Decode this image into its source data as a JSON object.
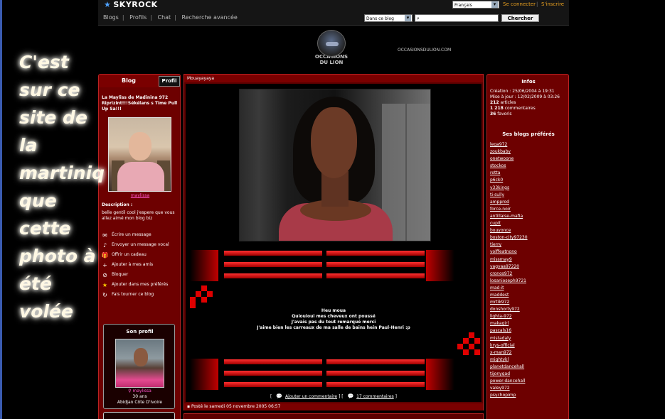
{
  "topbar": {
    "logo": "SKYROCK",
    "nav": [
      "Blogs",
      "Profils",
      "Chat",
      "Recherche avancée"
    ],
    "language": "Français",
    "login": "Se connecter",
    "register": "S'inscrire",
    "search_scope": "Dans ce blog",
    "search_value": "",
    "search_button": "Chercher"
  },
  "brand": {
    "line1": "OCCASIONS",
    "line2": "DU LION",
    "url": "OCCASIONSDULION.COM"
  },
  "caption": "C'est\nsur ce\nsite de\nla\nmartiniq\nque\ncette\nphoto à\nété\nvolée",
  "left": {
    "tab_blog": "Blog",
    "tab_profil": "Profil",
    "blog_title": "La Mayliss de Madinina 972 Riprizint!!!Sékélans s Time Pull Up Sa!!!",
    "username": "maylissa",
    "description_label": "Description :",
    "description": "belle gentil cool j'espere que vous allez aimé mon blog biz",
    "actions": [
      {
        "icon": "✉",
        "label": "Écrire un message"
      },
      {
        "icon": "♪",
        "label": "Envoyer un message vocal"
      },
      {
        "icon": "🎁",
        "label": "Offrir un cadeau"
      },
      {
        "icon": "+",
        "label": "Ajouter à mes amis"
      },
      {
        "icon": "⊘",
        "label": "Bloquer"
      },
      {
        "icon": "★",
        "label": "Ajouter dans mes préférés"
      },
      {
        "icon": "↻",
        "label": "Fais tourner ce blog"
      }
    ],
    "profile": {
      "heading": "Son profil",
      "name": "maylissa",
      "age": "30 ans",
      "location": "Abidjan Côte D'Ivoire"
    }
  },
  "center": {
    "header": "Mouayayaya",
    "message": [
      "Heu moua",
      "Quiouioui mes cheveux ont poussé",
      "J'avais pas du tout remarqué merci",
      "J'aime bien les carreaux de ma salle de bains hein Paul-Henri :p"
    ],
    "add_comment": "Ajouter un commentaire",
    "comment_count": "17 commentaires",
    "posted": "Posté le samedi 05 novembre 2005 06:57"
  },
  "right": {
    "info_heading": "Infos",
    "creation_label": "Création :",
    "creation": "25/06/2004 à 19:31",
    "update_label": "Mise à jour :",
    "update": "12/02/2009 à 03:26",
    "articles_count": "212",
    "articles_label": "articles",
    "comments_count": "1 218",
    "comments_label": "commentaires",
    "favs_count": "36",
    "favs_label": "favoris",
    "favorites_heading": "Ses blogs préférés",
    "favorites": [
      "lega972",
      "zoukbaby",
      "onetwoone",
      "stockos",
      "rotta",
      "p6ck0",
      "v33kings",
      "ti-sully",
      "ampprod",
      "force-noir",
      "antillaise-mafia",
      "cupit",
      "bouyonce",
      "boston-city97230",
      "tierry",
      "volffeatnono",
      "missmay9",
      "vagvaa97220",
      "cronos972",
      "losanioseph9721",
      "mad-it",
      "maddest",
      "mrtik972",
      "donshorty972",
      "lighta-972",
      "makagirl",
      "pascals16",
      "mistadaly",
      "krys-official",
      "x-man972",
      "mightykl",
      "planetdancehall",
      "tijonygad",
      "power-dancehall",
      "valey972",
      "psychopimp"
    ]
  }
}
